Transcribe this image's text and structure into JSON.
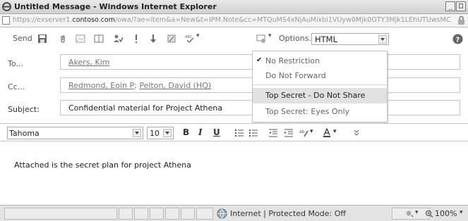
{
  "window": {
    "title": "Untitled Message - Windows Internet Explorer",
    "controls": {
      "minimize": "_",
      "maximize": "□",
      "close": "x"
    }
  },
  "address": {
    "url_pre": "https://exserver1.",
    "url_bold": "contoso.com",
    "url_post": "/owa/?ae=Item&a=New&t=IPM.Note&cc=MTQuMS4xNjAuMixbi1VUyw0Mjk0OTY3Mjk1LEhUTUwsMC"
  },
  "toolbar": {
    "send_label": "Send",
    "options_label": "Options...",
    "format_value": "HTML",
    "icons": [
      "save-icon",
      "attach-icon",
      "insert-image-icon",
      "address-book-icon",
      "check-names-icon",
      "importance-high-icon",
      "importance-low-icon",
      "message-flag-icon",
      "spelling-icon",
      "permission-icon",
      "help-icon"
    ]
  },
  "fields": {
    "to_label": "To...",
    "to_recipients": [
      "Akers, Kim"
    ],
    "cc_label": "Cc...",
    "cc_recipients": [
      "Redmond, Eoin P",
      "Pelton, David (HQ)"
    ],
    "cc_separator": "; ",
    "subject_label": "Subject:",
    "subject_value": "Confidential material for Project Athena"
  },
  "permission_menu": {
    "items": [
      {
        "label": "No Restriction",
        "checked": true,
        "highlighted": false
      },
      {
        "label": "Do Not Forward",
        "checked": false,
        "highlighted": false
      },
      {
        "label": "Top Secret - Do Not Share",
        "checked": false,
        "highlighted": true
      },
      {
        "label": "Top Secret: Eyes Only",
        "checked": false,
        "highlighted": false
      }
    ],
    "check_glyph": "✔"
  },
  "formatting": {
    "font": "Tahoma",
    "size": "10",
    "bold": "B",
    "italic": "I",
    "underline": "U"
  },
  "body": {
    "text": "Attached is the secret plan for project Athena"
  },
  "status": {
    "zone": "Internet | Protected Mode: Off",
    "zoom": "100%"
  },
  "colors": {
    "link": "#777777",
    "highlight": "#e1e1e1"
  }
}
